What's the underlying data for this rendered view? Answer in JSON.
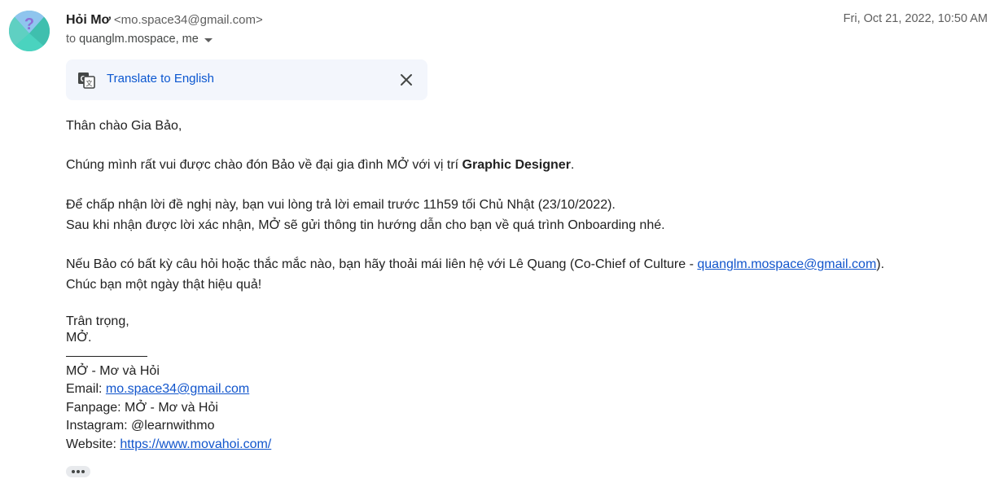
{
  "sender": {
    "name": "Hỏi Mơ",
    "email": "<mo.space34@gmail.com>"
  },
  "date": "Fri, Oct 21, 2022, 10:50 AM",
  "recipients": {
    "label": "to",
    "value": "quanglm.mospace, me"
  },
  "translate_bar": {
    "link_text": "Translate to English"
  },
  "body": {
    "greeting": "Thân chào Gia Bảo,",
    "p1_prefix": "Chúng mình rất vui được chào đón Bảo về đại gia đình MỞ với vị trí ",
    "p1_bold": "Graphic Designer",
    "p1_suffix": ".",
    "p2_line1": "Để chấp nhận lời đề nghị này, bạn vui lòng trả lời email trước 11h59 tối Chủ Nhật (23/10/2022).",
    "p2_line2": "Sau khi nhận được lời xác nhận, MỞ sẽ gửi thông tin hướng dẫn cho bạn về quá trình Onboarding nhé.",
    "p3_prefix": "Nếu Bảo có bất kỳ câu hỏi hoặc thắc mắc nào, bạn hãy thoải mái liên hệ với Lê Quang (Co-Chief of Culture - ",
    "p3_link": "quanglm.mospace@gmail.com",
    "p3_suffix": ").",
    "p3_line2": "Chúc bạn một ngày thật hiệu quả!",
    "signoff1": "Trân trọng,",
    "signoff2": "MỞ."
  },
  "signature": {
    "name": "MỞ - Mơ và Hỏi",
    "email_label": "Email: ",
    "email": "mo.space34@gmail.com",
    "fanpage": "Fanpage: MỞ - Mơ và Hỏi",
    "instagram": "Instagram: @learnwithmo",
    "website_label": "Website: ",
    "website": "https://www.movahoi.com/"
  },
  "colors": {
    "link": "#1155cc",
    "accent": "#0b57d0",
    "translate_bg": "#f3f6fc"
  }
}
